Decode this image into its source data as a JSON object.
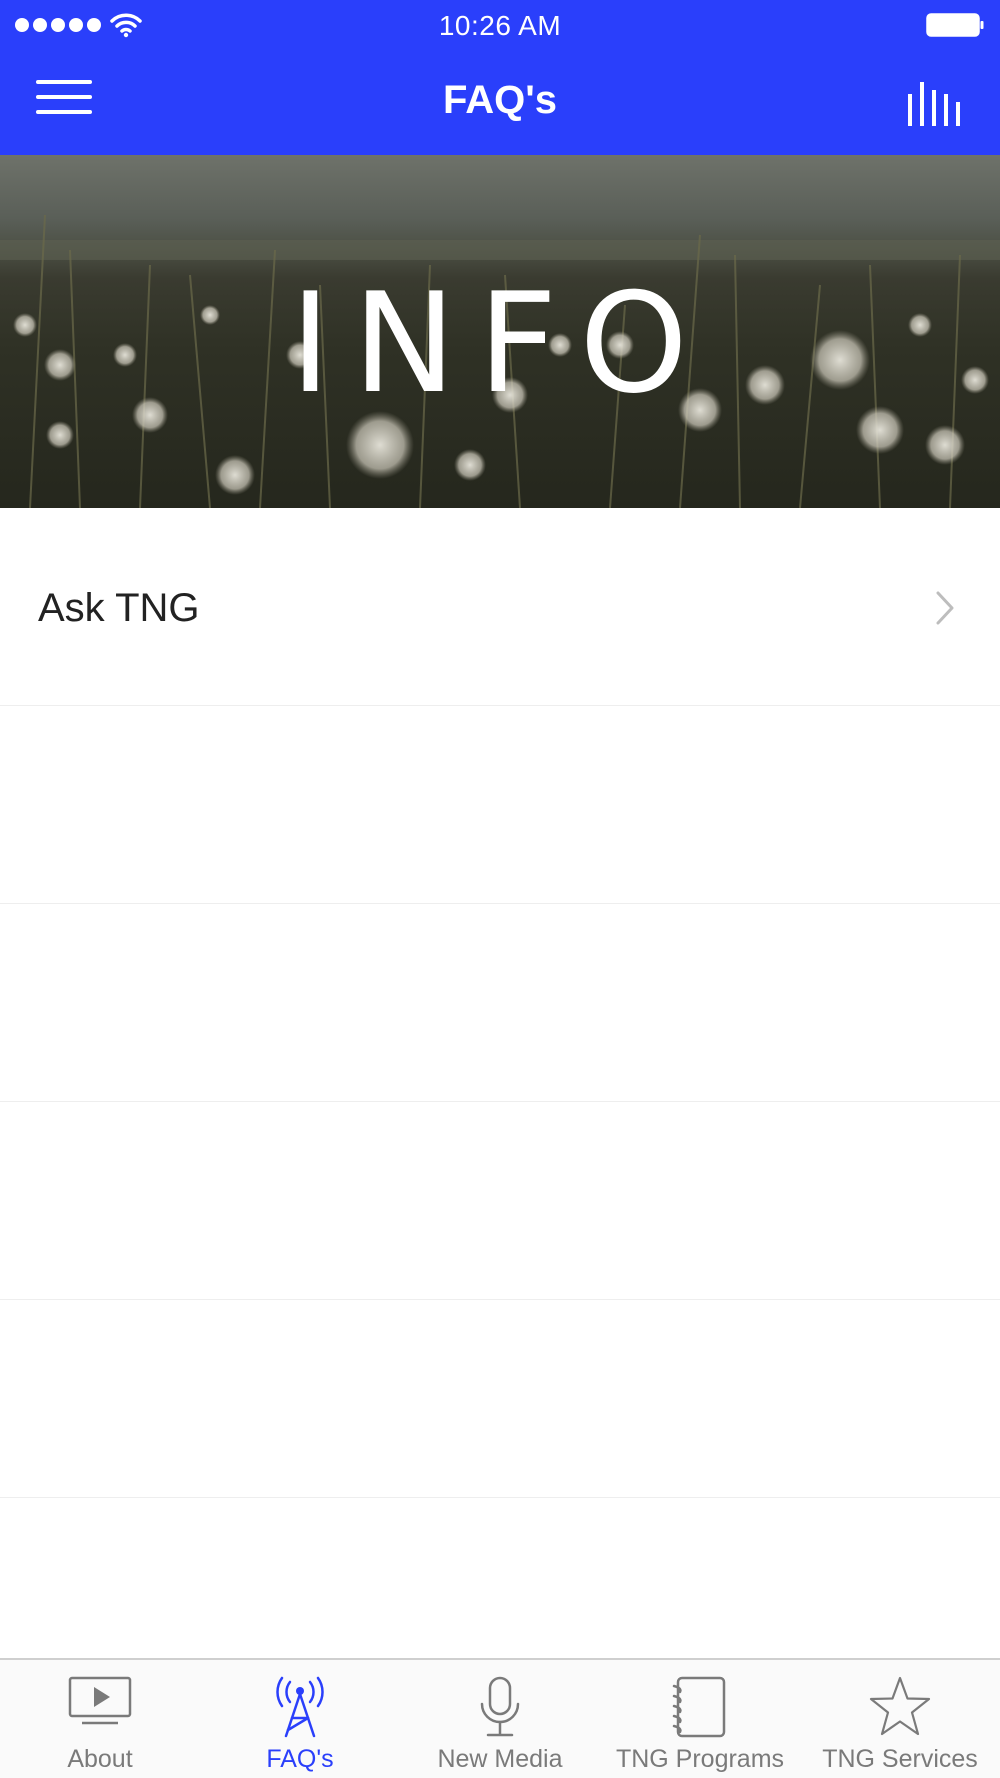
{
  "status_bar": {
    "time": "10:26 AM"
  },
  "nav": {
    "title": "FAQ's"
  },
  "hero": {
    "text": "INFO"
  },
  "list": {
    "items": [
      {
        "label": "Ask TNG"
      }
    ]
  },
  "tabs": [
    {
      "label": "About",
      "icon": "play-tv-icon"
    },
    {
      "label": "FAQ's",
      "icon": "radio-tower-icon",
      "active": true
    },
    {
      "label": "New Media",
      "icon": "microphone-icon"
    },
    {
      "label": "TNG Programs",
      "icon": "notebook-icon"
    },
    {
      "label": "TNG Services",
      "icon": "star-icon"
    }
  ],
  "colors": {
    "accent": "#2a3ffb",
    "tab_inactive": "#7a7a7a"
  }
}
